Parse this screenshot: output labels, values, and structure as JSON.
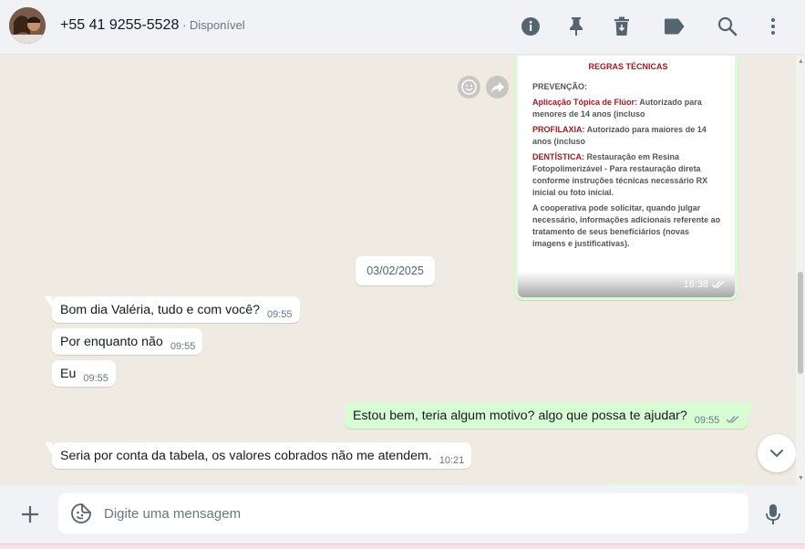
{
  "header": {
    "contact_name": "+55 41 9255-5528",
    "status": " · Disponível",
    "icons": [
      "info-icon",
      "pin-icon",
      "trash-icon",
      "label-icon",
      "search-icon",
      "more-vert-icon"
    ]
  },
  "image_message": {
    "heading": "REGRAS TÉCNICAS",
    "section": "PREVENÇÃO:",
    "items": [
      {
        "title": "Aplicação Tópica de Flúor:",
        "text": " Autorizado para menores de 14 anos (incluso"
      },
      {
        "title": "PROFILAXIA:",
        "text": " Autorizado para maiores de 14 anos (incluso"
      },
      {
        "title": "DENTÍSTICA:",
        "text": " Restauração em Resina Fotopolimerizável - Para restauração direta conforme instruções técnicas necessário RX inicial ou foto inicial."
      }
    ],
    "note": "A cooperativa pode solicitar, quando julgar necessário, informações adicionais referente ao tratamento de seus beneficiários (novas imagens e justificativas).",
    "time": "16:38"
  },
  "date_divider": "03/02/2025",
  "messages": [
    {
      "text": "Bom dia Valéria, tudo e com você?",
      "time": "09:55",
      "dir": "in"
    },
    {
      "text": "Por enquanto não",
      "time": "09:55",
      "dir": "in"
    },
    {
      "text": "Eu",
      "time": "09:55",
      "dir": "in"
    },
    {
      "text": "Estou bem, teria algum motivo? algo que possa te ajudar?",
      "time": "09:55",
      "dir": "out"
    },
    {
      "text": "Seria por conta da tabela, os valores cobrados não me atendem.",
      "time": "10:21",
      "dir": "in"
    }
  ],
  "composer": {
    "placeholder": "Digite uma mensagem"
  },
  "colors": {
    "outgoing_bubble": "#d9fdd3",
    "incoming_bubble": "#ffffff",
    "chat_background": "#efeae2",
    "read_ticks": "#53bdeb"
  }
}
